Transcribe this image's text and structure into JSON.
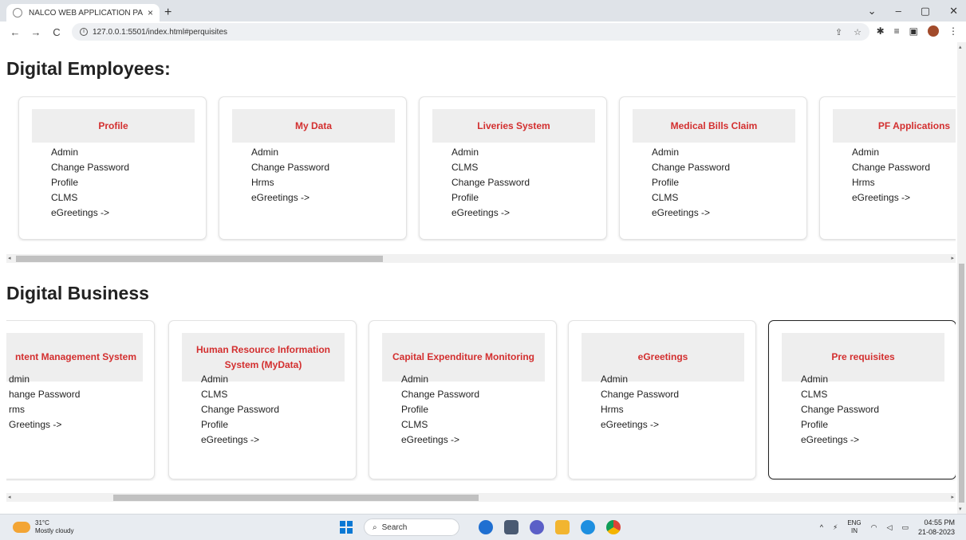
{
  "browser": {
    "tab_title": "NALCO WEB APPLICATION PAGE",
    "tab_close": "×",
    "new_tab": "+",
    "url": "127.0.0.1:5501/index.html#perquisites",
    "window_controls": [
      "⌄",
      "–",
      "▢",
      "✕"
    ],
    "nav": {
      "back": "←",
      "forward": "→",
      "reload": "C"
    }
  },
  "sections": {
    "employees": {
      "title": "Digital Employees:",
      "cards": [
        {
          "title": "Profile",
          "items": [
            "Admin",
            "Change Password",
            "Profile",
            "CLMS",
            "eGreetings ->"
          ]
        },
        {
          "title": "My Data",
          "items": [
            "Admin",
            "Change Password",
            "Hrms",
            "eGreetings ->"
          ]
        },
        {
          "title": "Liveries System",
          "items": [
            "Admin",
            "CLMS",
            "Change Password",
            "Profile",
            "eGreetings ->"
          ]
        },
        {
          "title": "Medical Bills Claim",
          "items": [
            "Admin",
            "Change Password",
            "Profile",
            "CLMS",
            "eGreetings ->"
          ]
        },
        {
          "title": "PF Applications",
          "items": [
            "Admin",
            "Change Password",
            "Hrms",
            "eGreetings ->"
          ]
        }
      ]
    },
    "business": {
      "title": "Digital Business",
      "cards": [
        {
          "title": "ntent Management System",
          "items": [
            "dmin",
            "hange Password",
            "rms",
            "Greetings ->"
          ]
        },
        {
          "title": "Human Resource Information System (MyData)",
          "items": [
            "Admin",
            "CLMS",
            "Change Password",
            "Profile",
            "eGreetings ->"
          ]
        },
        {
          "title": "Capital Expenditure Monitoring",
          "items": [
            "Admin",
            "Change Password",
            "Profile",
            "CLMS",
            "eGreetings ->"
          ]
        },
        {
          "title": "eGreetings",
          "items": [
            "Admin",
            "Change Password",
            "Hrms",
            "eGreetings ->"
          ]
        },
        {
          "title": "Pre requisites",
          "items": [
            "Admin",
            "CLMS",
            "Change Password",
            "Profile",
            "eGreetings ->"
          ]
        }
      ]
    }
  },
  "taskbar": {
    "temp": "31°C",
    "weather": "Mostly cloudy",
    "search": "Search",
    "lang_top": "ENG",
    "lang_bottom": "IN",
    "time": "04:55 PM",
    "date": "21-08-2023"
  }
}
